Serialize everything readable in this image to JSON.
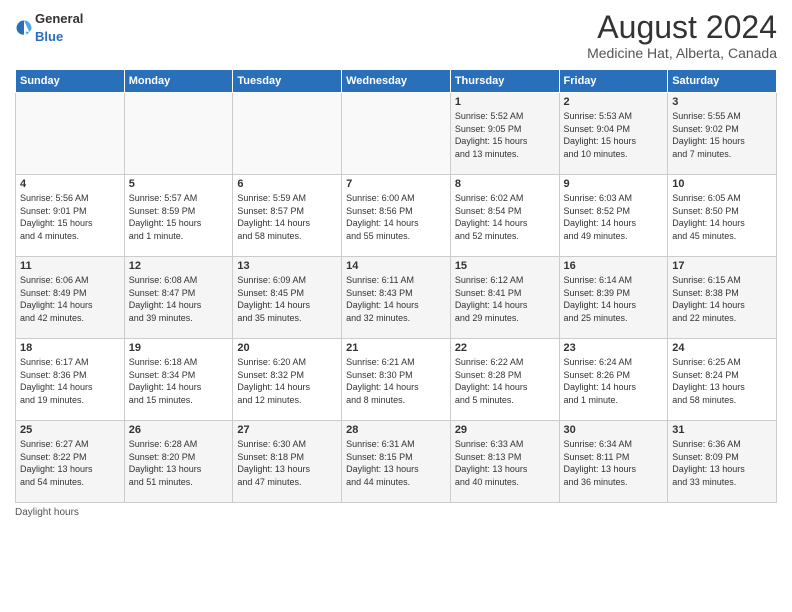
{
  "header": {
    "logo_general": "General",
    "logo_blue": "Blue",
    "title": "August 2024",
    "subtitle": "Medicine Hat, Alberta, Canada"
  },
  "days_of_week": [
    "Sunday",
    "Monday",
    "Tuesday",
    "Wednesday",
    "Thursday",
    "Friday",
    "Saturday"
  ],
  "weeks": [
    [
      {
        "day": "",
        "info": ""
      },
      {
        "day": "",
        "info": ""
      },
      {
        "day": "",
        "info": ""
      },
      {
        "day": "",
        "info": ""
      },
      {
        "day": "1",
        "info": "Sunrise: 5:52 AM\nSunset: 9:05 PM\nDaylight: 15 hours\nand 13 minutes."
      },
      {
        "day": "2",
        "info": "Sunrise: 5:53 AM\nSunset: 9:04 PM\nDaylight: 15 hours\nand 10 minutes."
      },
      {
        "day": "3",
        "info": "Sunrise: 5:55 AM\nSunset: 9:02 PM\nDaylight: 15 hours\nand 7 minutes."
      }
    ],
    [
      {
        "day": "4",
        "info": "Sunrise: 5:56 AM\nSunset: 9:01 PM\nDaylight: 15 hours\nand 4 minutes."
      },
      {
        "day": "5",
        "info": "Sunrise: 5:57 AM\nSunset: 8:59 PM\nDaylight: 15 hours\nand 1 minute."
      },
      {
        "day": "6",
        "info": "Sunrise: 5:59 AM\nSunset: 8:57 PM\nDaylight: 14 hours\nand 58 minutes."
      },
      {
        "day": "7",
        "info": "Sunrise: 6:00 AM\nSunset: 8:56 PM\nDaylight: 14 hours\nand 55 minutes."
      },
      {
        "day": "8",
        "info": "Sunrise: 6:02 AM\nSunset: 8:54 PM\nDaylight: 14 hours\nand 52 minutes."
      },
      {
        "day": "9",
        "info": "Sunrise: 6:03 AM\nSunset: 8:52 PM\nDaylight: 14 hours\nand 49 minutes."
      },
      {
        "day": "10",
        "info": "Sunrise: 6:05 AM\nSunset: 8:50 PM\nDaylight: 14 hours\nand 45 minutes."
      }
    ],
    [
      {
        "day": "11",
        "info": "Sunrise: 6:06 AM\nSunset: 8:49 PM\nDaylight: 14 hours\nand 42 minutes."
      },
      {
        "day": "12",
        "info": "Sunrise: 6:08 AM\nSunset: 8:47 PM\nDaylight: 14 hours\nand 39 minutes."
      },
      {
        "day": "13",
        "info": "Sunrise: 6:09 AM\nSunset: 8:45 PM\nDaylight: 14 hours\nand 35 minutes."
      },
      {
        "day": "14",
        "info": "Sunrise: 6:11 AM\nSunset: 8:43 PM\nDaylight: 14 hours\nand 32 minutes."
      },
      {
        "day": "15",
        "info": "Sunrise: 6:12 AM\nSunset: 8:41 PM\nDaylight: 14 hours\nand 29 minutes."
      },
      {
        "day": "16",
        "info": "Sunrise: 6:14 AM\nSunset: 8:39 PM\nDaylight: 14 hours\nand 25 minutes."
      },
      {
        "day": "17",
        "info": "Sunrise: 6:15 AM\nSunset: 8:38 PM\nDaylight: 14 hours\nand 22 minutes."
      }
    ],
    [
      {
        "day": "18",
        "info": "Sunrise: 6:17 AM\nSunset: 8:36 PM\nDaylight: 14 hours\nand 19 minutes."
      },
      {
        "day": "19",
        "info": "Sunrise: 6:18 AM\nSunset: 8:34 PM\nDaylight: 14 hours\nand 15 minutes."
      },
      {
        "day": "20",
        "info": "Sunrise: 6:20 AM\nSunset: 8:32 PM\nDaylight: 14 hours\nand 12 minutes."
      },
      {
        "day": "21",
        "info": "Sunrise: 6:21 AM\nSunset: 8:30 PM\nDaylight: 14 hours\nand 8 minutes."
      },
      {
        "day": "22",
        "info": "Sunrise: 6:22 AM\nSunset: 8:28 PM\nDaylight: 14 hours\nand 5 minutes."
      },
      {
        "day": "23",
        "info": "Sunrise: 6:24 AM\nSunset: 8:26 PM\nDaylight: 14 hours\nand 1 minute."
      },
      {
        "day": "24",
        "info": "Sunrise: 6:25 AM\nSunset: 8:24 PM\nDaylight: 13 hours\nand 58 minutes."
      }
    ],
    [
      {
        "day": "25",
        "info": "Sunrise: 6:27 AM\nSunset: 8:22 PM\nDaylight: 13 hours\nand 54 minutes."
      },
      {
        "day": "26",
        "info": "Sunrise: 6:28 AM\nSunset: 8:20 PM\nDaylight: 13 hours\nand 51 minutes."
      },
      {
        "day": "27",
        "info": "Sunrise: 6:30 AM\nSunset: 8:18 PM\nDaylight: 13 hours\nand 47 minutes."
      },
      {
        "day": "28",
        "info": "Sunrise: 6:31 AM\nSunset: 8:15 PM\nDaylight: 13 hours\nand 44 minutes."
      },
      {
        "day": "29",
        "info": "Sunrise: 6:33 AM\nSunset: 8:13 PM\nDaylight: 13 hours\nand 40 minutes."
      },
      {
        "day": "30",
        "info": "Sunrise: 6:34 AM\nSunset: 8:11 PM\nDaylight: 13 hours\nand 36 minutes."
      },
      {
        "day": "31",
        "info": "Sunrise: 6:36 AM\nSunset: 8:09 PM\nDaylight: 13 hours\nand 33 minutes."
      }
    ]
  ],
  "footer": "Daylight hours"
}
